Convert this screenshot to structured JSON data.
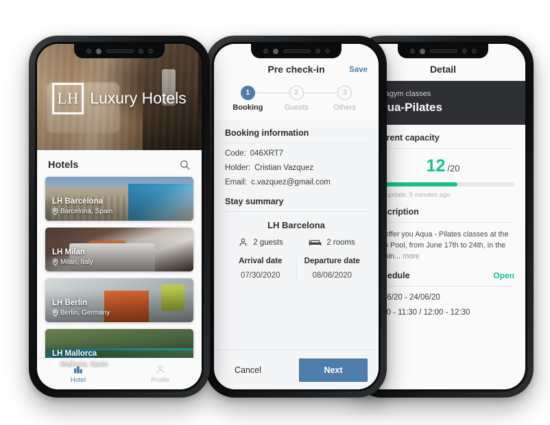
{
  "phone1": {
    "brand": {
      "mark": "LH",
      "name": "Luxury Hotels"
    },
    "list_header": {
      "title": "Hotels",
      "search_icon": "search-icon"
    },
    "hotels": [
      {
        "name": "LH Barcelona",
        "location": "Barcelona, Spain"
      },
      {
        "name": "LH Milan",
        "location": "Milan, Italy"
      },
      {
        "name": "LH Berlin",
        "location": "Berlin, Germany"
      },
      {
        "name": "LH Mallorca",
        "location": "Mallorca, Spain"
      }
    ],
    "tabs": [
      {
        "label": "Hotel",
        "icon": "building-icon",
        "active": true
      },
      {
        "label": "Profile",
        "icon": "person-icon",
        "active": false
      }
    ]
  },
  "phone2": {
    "title": "Pre check-in",
    "save_label": "Save",
    "steps": [
      {
        "number": "1",
        "label": "Booking",
        "state": "done"
      },
      {
        "number": "2",
        "label": "Guests",
        "state": "todo"
      },
      {
        "number": "3",
        "label": "Others",
        "state": "todo"
      }
    ],
    "booking": {
      "section_title": "Booking information",
      "fields": [
        {
          "key": "Code:",
          "value": "046XRT7"
        },
        {
          "key": "Holder:",
          "value": "Cristian Vazquez"
        },
        {
          "key": "Email:",
          "value": "c.vazquez@gmail.com"
        }
      ]
    },
    "stay": {
      "section_title": "Stay summary",
      "hotel": "LH Barcelona",
      "guests": "2 guests",
      "rooms": "2 rooms",
      "arrival_label": "Arrival date",
      "arrival_value": "07/30/2020",
      "departure_label": "Departure date",
      "departure_value": "08/08/2020"
    },
    "footer": {
      "cancel_label": "Cancel",
      "next_label": "Next"
    }
  },
  "phone3": {
    "title": "Detail",
    "hero": {
      "category": "Aquagym classes",
      "name": "Aqua-Pilates"
    },
    "capacity": {
      "section_title": "Current capacity",
      "current": "12",
      "total": "/20",
      "percent": 60,
      "last_update": "Last update: 5 minutes ago"
    },
    "description": {
      "section_title": "Description",
      "text": "We offer you Aqua - Pilates classes at the Lago Pool, from June 17th to 24th, in the mornin...",
      "more_label": "more"
    },
    "schedule": {
      "section_title": "Schedule",
      "status": "Open",
      "dates": "17/06/20 - 24/06/20",
      "times": "11:00 - 11:30 / 12:00 - 12:30"
    }
  },
  "colors": {
    "accent_blue": "#4d7da9",
    "accent_green": "#17c183",
    "dark_hero": "#2f3033"
  }
}
